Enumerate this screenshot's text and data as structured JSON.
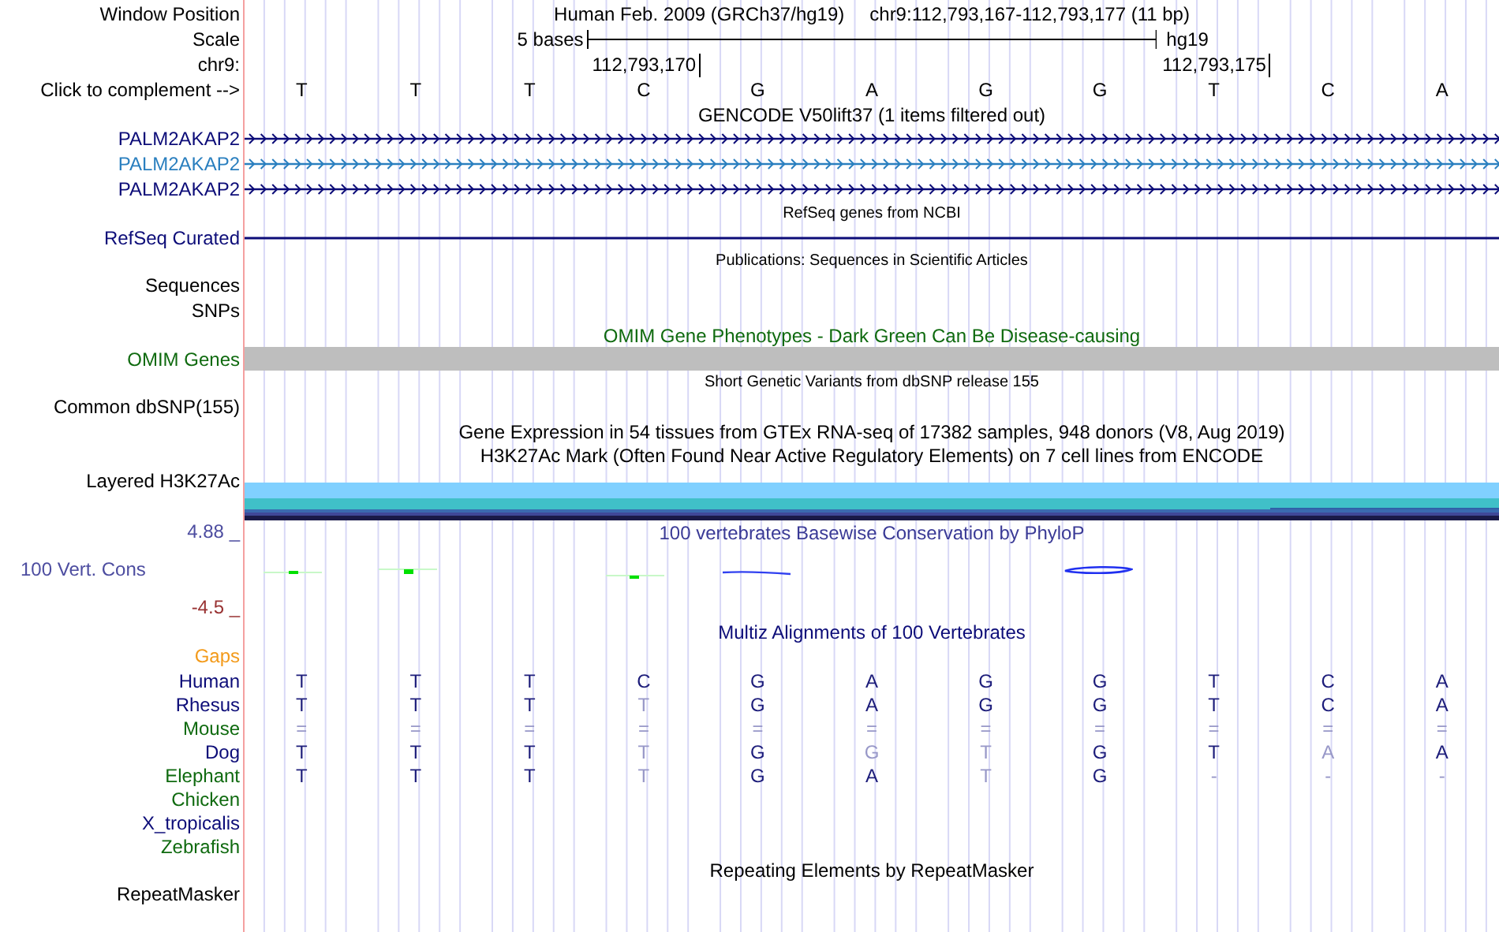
{
  "rows": [
    {
      "kind": "position",
      "label": "Window Position",
      "assembly": "Human Feb. 2009 (GRCh37/hg19)",
      "range": "chr9:112,793,167-112,793,177 (11 bp)",
      "color": "#000000"
    },
    {
      "kind": "scale",
      "label": "Scale",
      "span": "5 bases",
      "assembly": "hg19",
      "color": "#000000"
    },
    {
      "kind": "coords",
      "label": "chr9:",
      "ticks": [
        "112,793,170",
        "112,793,175"
      ],
      "color": "#000000"
    },
    {
      "kind": "bases",
      "label": "Click to complement -->",
      "bases": [
        "T",
        "T",
        "T",
        "C",
        "G",
        "A",
        "G",
        "G",
        "T",
        "C",
        "A"
      ],
      "color": "#000000"
    },
    {
      "kind": "title",
      "text": "GENCODE V50lift37 (1 items filtered out)",
      "color": "#000000"
    },
    {
      "kind": "gene",
      "label": "PALM2AKAP2",
      "color": "#0c0c78"
    },
    {
      "kind": "gene",
      "label": "PALM2AKAP2",
      "color": "#2a7fbf"
    },
    {
      "kind": "gene",
      "label": "PALM2AKAP2",
      "color": "#0c0c78"
    },
    {
      "kind": "small_title",
      "text": "RefSeq genes from NCBI",
      "color": "#000000"
    },
    {
      "kind": "line",
      "label": "RefSeq Curated",
      "color": "#0c0c78"
    },
    {
      "kind": "small_title",
      "text": "Publications: Sequences in Scientific Articles",
      "color": "#000000"
    },
    {
      "kind": "label",
      "label": "Sequences",
      "color": "#000000"
    },
    {
      "kind": "label",
      "label": "SNPs",
      "color": "#000000"
    },
    {
      "kind": "title",
      "text": "OMIM Gene Phenotypes - Dark Green Can Be Disease-causing",
      "color": "#0f6a0f"
    },
    {
      "kind": "bar",
      "label": "OMIM Genes",
      "color": "#0f6a0f"
    },
    {
      "kind": "small_title",
      "text": "Short Genetic Variants from dbSNP release 155",
      "color": "#000000"
    },
    {
      "kind": "label",
      "label": "Common dbSNP(155)",
      "color": "#000000"
    },
    {
      "kind": "title",
      "text": "Gene Expression in 54 tissues from GTEx RNA-seq of 17382 samples, 948 donors (V8, Aug 2019)",
      "color": "#000000"
    },
    {
      "kind": "title",
      "text": "H3K27Ac Mark (Often Found Near Active Regulatory Elements) on 7 cell lines from ENCODE",
      "color": "#000000"
    },
    {
      "kind": "layered",
      "label": "Layered H3K27Ac",
      "color": "#000000"
    },
    {
      "kind": "wiggle",
      "title": "100 vertebrates Basewise Conservation by PhyloP",
      "max": "4.88 _",
      "label": "100 Vert. Cons",
      "min": "-4.5 _"
    },
    {
      "kind": "title",
      "text": "Multiz Alignments of 100 Vertebrates",
      "color": "#0c0c78"
    },
    {
      "kind": "label",
      "label": "Gaps",
      "color": "#f39a1a"
    },
    {
      "kind": "species",
      "label": "Human",
      "color": "#0c0c78",
      "bases": [
        {
          "base": "T",
          "faded": false
        },
        {
          "base": "T",
          "faded": false
        },
        {
          "base": "T",
          "faded": false
        },
        {
          "base": "C",
          "faded": false
        },
        {
          "base": "G",
          "faded": false
        },
        {
          "base": "A",
          "faded": false
        },
        {
          "base": "G",
          "faded": false
        },
        {
          "base": "G",
          "faded": false
        },
        {
          "base": "T",
          "faded": false
        },
        {
          "base": "C",
          "faded": false
        },
        {
          "base": "A",
          "faded": false
        }
      ]
    },
    {
      "kind": "species",
      "label": "Rhesus",
      "color": "#0c0c78",
      "bases": [
        {
          "base": "T",
          "faded": false
        },
        {
          "base": "T",
          "faded": false
        },
        {
          "base": "T",
          "faded": false
        },
        {
          "base": "T",
          "faded": true
        },
        {
          "base": "G",
          "faded": false
        },
        {
          "base": "A",
          "faded": false
        },
        {
          "base": "G",
          "faded": false
        },
        {
          "base": "G",
          "faded": false
        },
        {
          "base": "T",
          "faded": false
        },
        {
          "base": "C",
          "faded": false
        },
        {
          "base": "A",
          "faded": false
        }
      ]
    },
    {
      "kind": "species",
      "label": "Mouse",
      "color": "#0f6a0f",
      "bases": [
        {
          "base": "=",
          "faded": true
        },
        {
          "base": "=",
          "faded": true
        },
        {
          "base": "=",
          "faded": true
        },
        {
          "base": "=",
          "faded": true
        },
        {
          "base": "=",
          "faded": true
        },
        {
          "base": "=",
          "faded": true
        },
        {
          "base": "=",
          "faded": true
        },
        {
          "base": "=",
          "faded": true
        },
        {
          "base": "=",
          "faded": true
        },
        {
          "base": "=",
          "faded": true
        },
        {
          "base": "=",
          "faded": true
        }
      ]
    },
    {
      "kind": "species",
      "label": "Dog",
      "color": "#0c0c78",
      "bases": [
        {
          "base": "T",
          "faded": false
        },
        {
          "base": "T",
          "faded": false
        },
        {
          "base": "T",
          "faded": false
        },
        {
          "base": "T",
          "faded": true
        },
        {
          "base": "G",
          "faded": false
        },
        {
          "base": "G",
          "faded": true
        },
        {
          "base": "T",
          "faded": true
        },
        {
          "base": "G",
          "faded": false
        },
        {
          "base": "T",
          "faded": false
        },
        {
          "base": "A",
          "faded": true
        },
        {
          "base": "A",
          "faded": false
        }
      ]
    },
    {
      "kind": "species",
      "label": "Elephant",
      "color": "#0f6a0f",
      "bases": [
        {
          "base": "T",
          "faded": false
        },
        {
          "base": "T",
          "faded": false
        },
        {
          "base": "T",
          "faded": false
        },
        {
          "base": "T",
          "faded": true
        },
        {
          "base": "G",
          "faded": false
        },
        {
          "base": "A",
          "faded": false
        },
        {
          "base": "T",
          "faded": true
        },
        {
          "base": "G",
          "faded": false
        },
        {
          "base": "-",
          "faded": true
        },
        {
          "base": "-",
          "faded": true
        },
        {
          "base": "-",
          "faded": true
        }
      ]
    },
    {
      "kind": "species",
      "label": "Chicken",
      "color": "#0f6a0f"
    },
    {
      "kind": "species",
      "label": "X_tropicalis",
      "color": "#0c0c78"
    },
    {
      "kind": "species",
      "label": "Zebrafish",
      "color": "#0f6a0f"
    },
    {
      "kind": "title",
      "text": "Repeating Elements by RepeatMasker",
      "color": "#000000"
    },
    {
      "kind": "label",
      "label": "RepeatMasker",
      "color": "#000000"
    }
  ]
}
